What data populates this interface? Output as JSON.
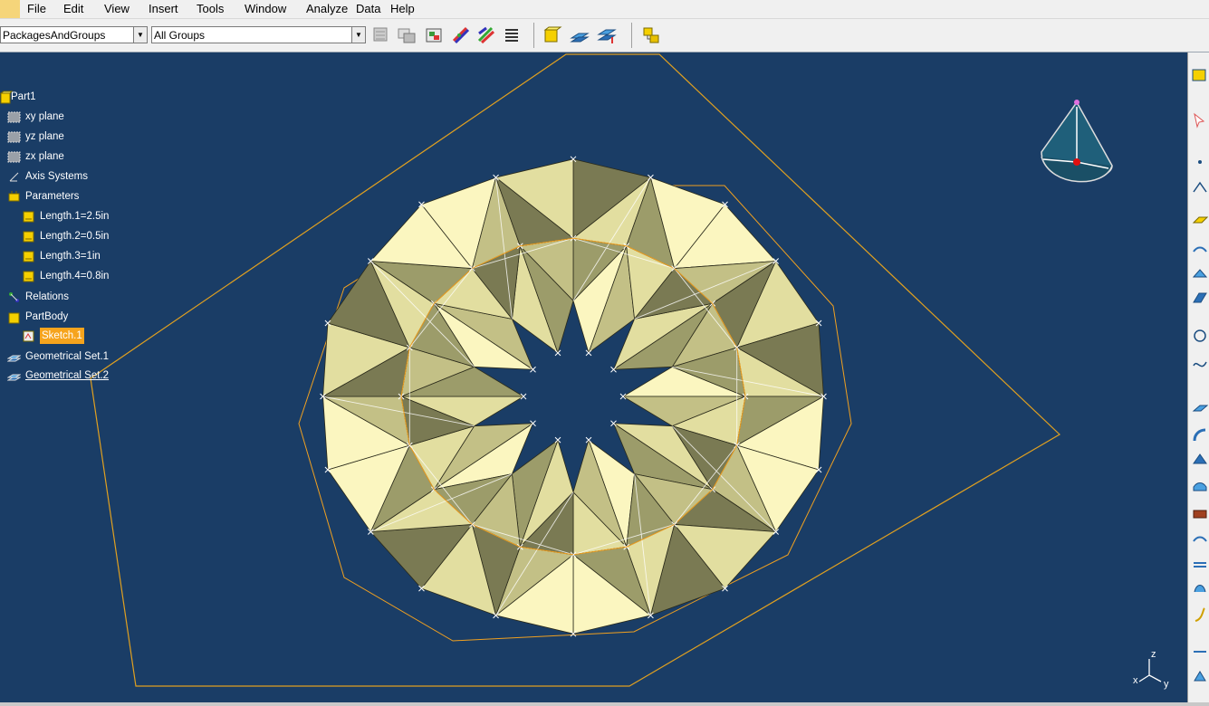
{
  "menu": {
    "items": [
      "File",
      "Edit",
      "View",
      "Insert",
      "Tools",
      "Window",
      "Analyze",
      "Data",
      "Help"
    ]
  },
  "toolbar": {
    "filter_value": "PackagesAndGroups",
    "group_value": "All Groups"
  },
  "tree": {
    "root": "Part1",
    "planes": [
      "xy plane",
      "yz plane",
      "zx plane"
    ],
    "axis_systems": "Axis Systems",
    "parameters": "Parameters",
    "lengths": [
      "Length.1=2.5in",
      "Length.2=0.5in",
      "Length.3=1in",
      "Length.4=0.8in"
    ],
    "relations": "Relations",
    "partbody": "PartBody",
    "sketch": "Sketch.1",
    "geoset1": "Geometrical Set.1",
    "geoset2": "Geometrical Set.2"
  },
  "compass": {
    "z": "z",
    "x": "x",
    "y": "y"
  },
  "colors": {
    "background": "#1a3d66",
    "selection": "#f6a41d",
    "geometry_line": "#f0a020"
  }
}
